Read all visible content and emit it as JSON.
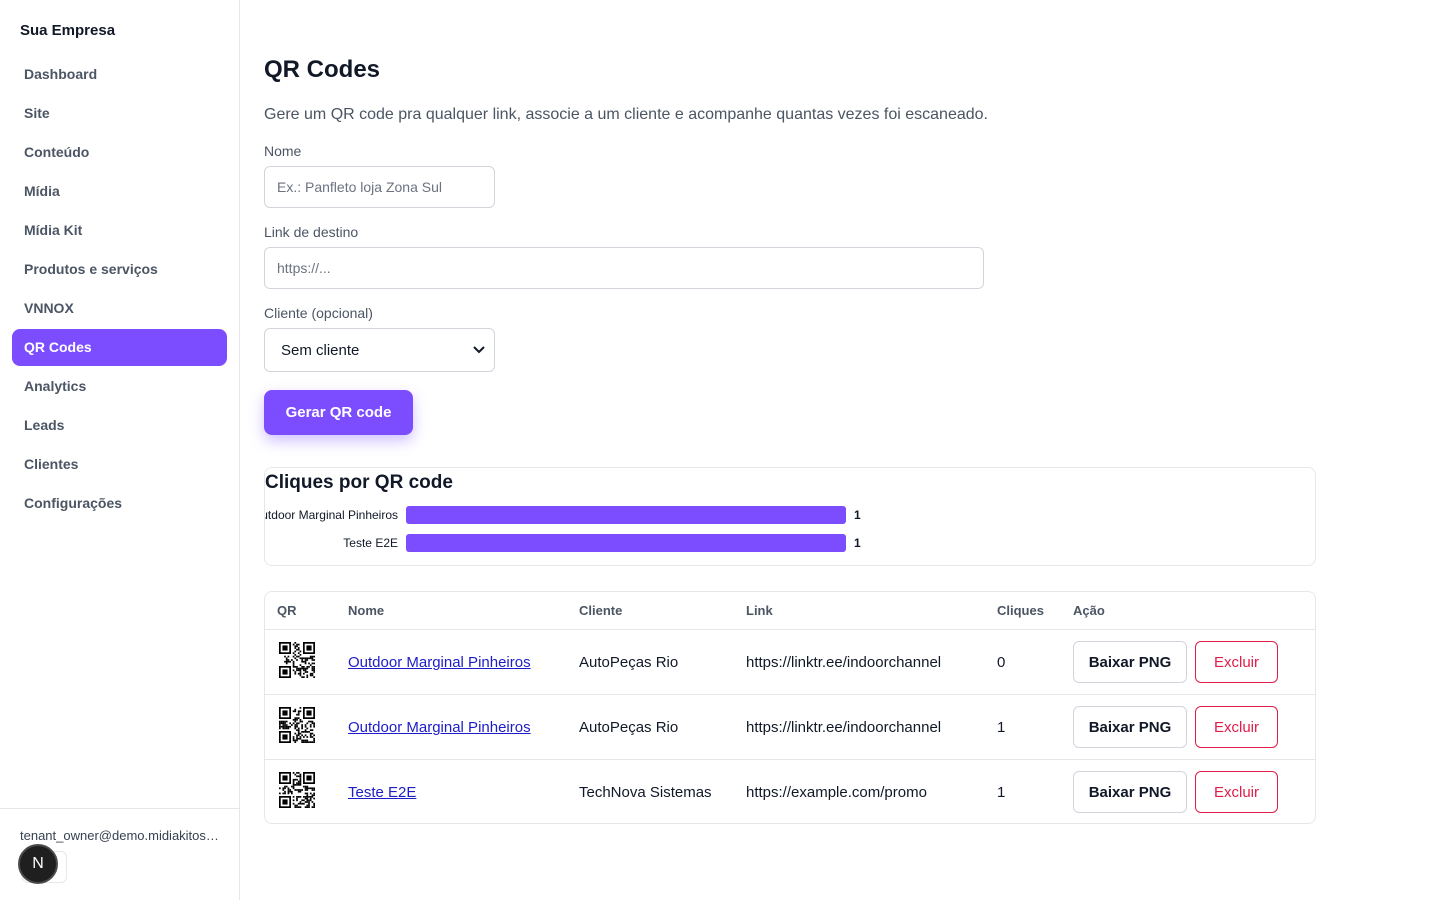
{
  "sidebar": {
    "brand": "Sua Empresa",
    "items": [
      {
        "label": "Dashboard"
      },
      {
        "label": "Site"
      },
      {
        "label": "Conteúdo"
      },
      {
        "label": "Mídia"
      },
      {
        "label": "Mídia Kit"
      },
      {
        "label": "Produtos e serviços"
      },
      {
        "label": "VNNOX"
      },
      {
        "label": "QR Codes",
        "active": true
      },
      {
        "label": "Analytics"
      },
      {
        "label": "Leads"
      },
      {
        "label": "Clientes"
      },
      {
        "label": "Configurações"
      }
    ],
    "user_email": "tenant_owner@demo.midiakitos.com",
    "badge_letter": "N"
  },
  "page": {
    "title": "QR Codes",
    "description": "Gere um QR code pra qualquer link, associe a um cliente e acompanhe quantas vezes foi escaneado."
  },
  "form": {
    "name_label": "Nome",
    "name_placeholder": "Ex.: Panfleto loja Zona Sul",
    "link_label": "Link de destino",
    "link_placeholder": "https://...",
    "client_label": "Cliente (opcional)",
    "client_selected": "Sem cliente",
    "submit_label": "Gerar QR code"
  },
  "chart_data": {
    "type": "bar",
    "orientation": "horizontal",
    "title": "Cliques por QR code",
    "categories": [
      "Outdoor Marginal Pinheiros",
      "Teste E2E"
    ],
    "values": [
      1,
      1
    ],
    "xlim": [
      0,
      1
    ],
    "bar_color": "#7c4dff",
    "grid": false,
    "legend": "none"
  },
  "table": {
    "headers": {
      "qr": "QR",
      "name": "Nome",
      "client": "Cliente",
      "link": "Link",
      "clicks": "Cliques",
      "action": "Ação"
    },
    "download_label": "Baixar PNG",
    "delete_label": "Excluir",
    "rows": [
      {
        "name": "Outdoor Marginal Pinheiros",
        "client": "AutoPeças Rio",
        "link": "https://linktr.ee/indoorchannel",
        "clicks": "0"
      },
      {
        "name": "Outdoor Marginal Pinheiros",
        "client": "AutoPeças Rio",
        "link": "https://linktr.ee/indoorchannel",
        "clicks": "1"
      },
      {
        "name": "Teste E2E",
        "client": "TechNova Sistemas",
        "link": "https://example.com/promo",
        "clicks": "1"
      }
    ]
  },
  "colors": {
    "accent": "#7c4dff",
    "danger": "#e11d48",
    "link": "#1d1dc8"
  }
}
